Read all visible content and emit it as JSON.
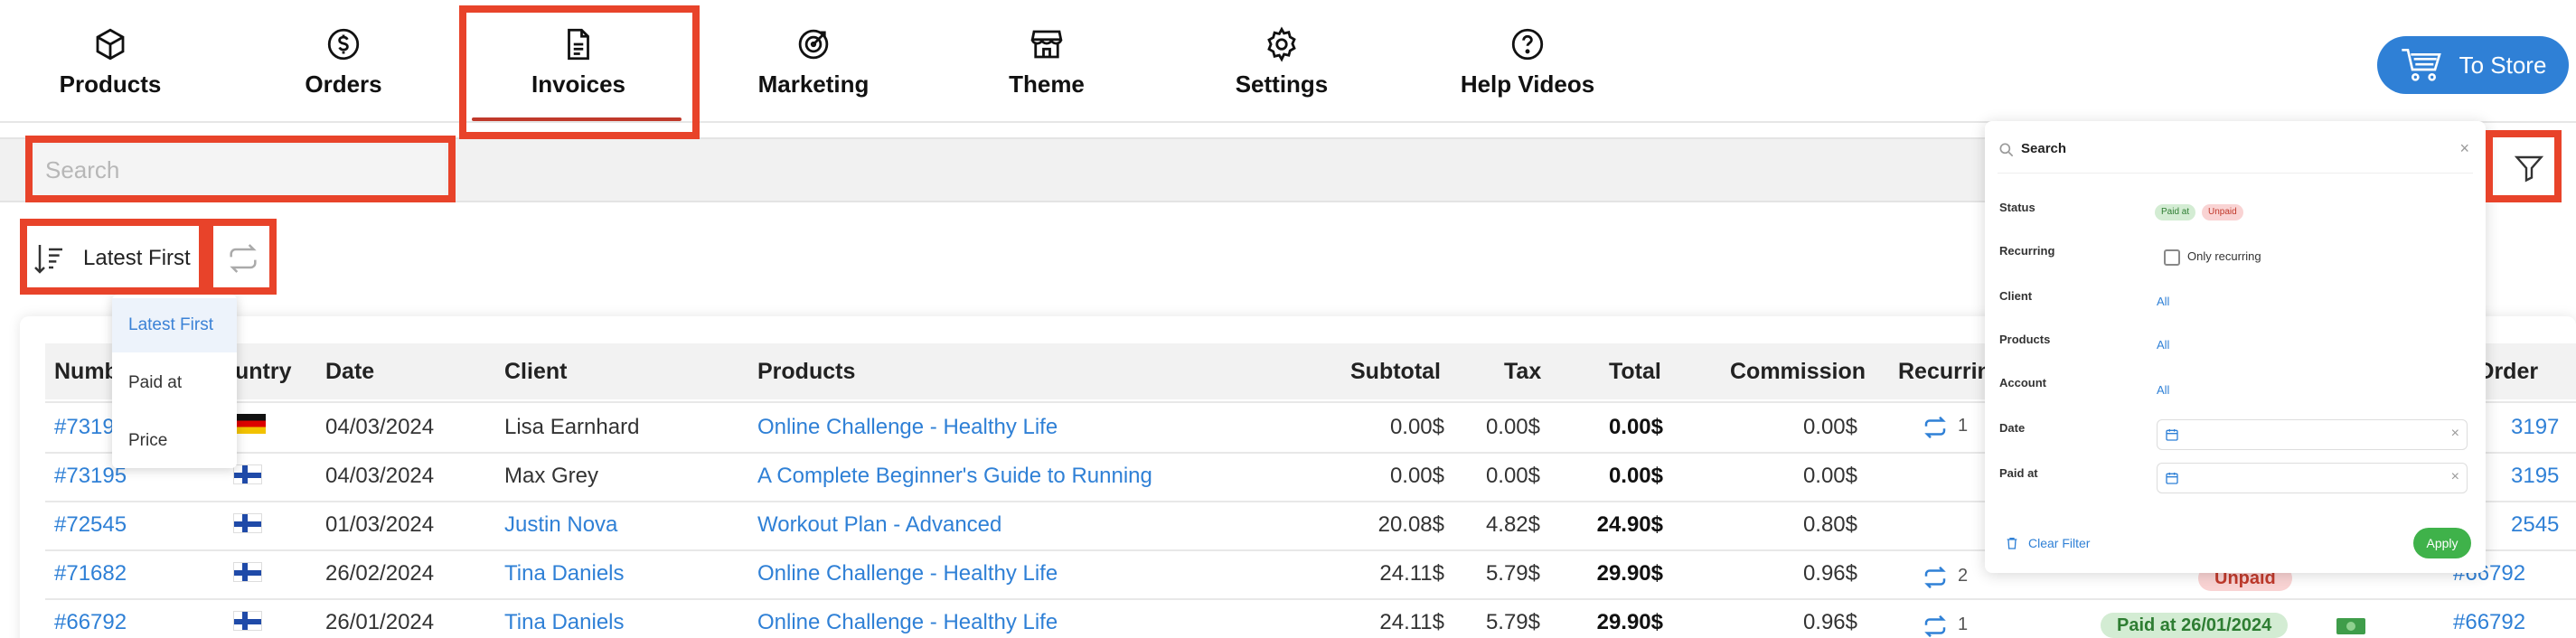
{
  "nav": {
    "tabs": [
      {
        "label": "Products",
        "icon": "box-icon"
      },
      {
        "label": "Orders",
        "icon": "dollar-icon"
      },
      {
        "label": "Invoices",
        "icon": "document-icon",
        "active": true
      },
      {
        "label": "Marketing",
        "icon": "target-icon"
      },
      {
        "label": "Theme",
        "icon": "shop-icon"
      },
      {
        "label": "Settings",
        "icon": "gear-icon"
      },
      {
        "label": "Help Videos",
        "icon": "help-icon"
      }
    ],
    "store_button": "To Store"
  },
  "search": {
    "placeholder": "Search"
  },
  "sort": {
    "label": "Latest First",
    "options": [
      "Latest First",
      "Paid at",
      "Price"
    ],
    "selected": "Latest First"
  },
  "table": {
    "columns": [
      "Number",
      "Country",
      "Date",
      "Client",
      "Products",
      "Subtotal",
      "Tax",
      "Total",
      "Commission",
      "Recurring",
      "Order"
    ],
    "col_number_visible": "Numb",
    "col_country_visible": "untry",
    "col_recurring_visible": "Recurrin",
    "col_order_visible": "Order",
    "rows": [
      {
        "number": "#7319",
        "country": "DE",
        "date": "04/03/2024",
        "client": "Lisa Earnhard",
        "client_link": false,
        "product": "Online Challenge - Healthy Life",
        "subtotal": "0.00$",
        "tax": "0.00$",
        "total": "0.00$",
        "commission": "0.00$",
        "recurring": "1",
        "status": "",
        "order": "3197"
      },
      {
        "number": "#73195",
        "country": "FI",
        "date": "04/03/2024",
        "client": "Max Grey",
        "client_link": false,
        "product": "A Complete Beginner's Guide to Running",
        "subtotal": "0.00$",
        "tax": "0.00$",
        "total": "0.00$",
        "commission": "0.00$",
        "recurring": "",
        "status": "",
        "order": "3195"
      },
      {
        "number": "#72545",
        "country": "FI",
        "date": "01/03/2024",
        "client": "Justin Nova",
        "client_link": true,
        "product": "Workout Plan - Advanced",
        "subtotal": "20.08$",
        "tax": "4.82$",
        "total": "24.90$",
        "commission": "0.80$",
        "recurring": "",
        "status": "",
        "order": "2545"
      },
      {
        "number": "#71682",
        "country": "FI",
        "date": "26/02/2024",
        "client": "Tina Daniels",
        "client_link": true,
        "product": "Online Challenge - Healthy Life",
        "subtotal": "24.11$",
        "tax": "5.79$",
        "total": "29.90$",
        "commission": "0.96$",
        "recurring": "2",
        "status": "Unpaid",
        "order": "#66792"
      },
      {
        "number": "#66792",
        "country": "FI",
        "date": "26/01/2024",
        "client": "Tina Daniels",
        "client_link": true,
        "product": "Online Challenge - Healthy Life",
        "subtotal": "24.11$",
        "tax": "5.79$",
        "total": "29.90$",
        "commission": "0.96$",
        "recurring": "1",
        "status": "Paid at 26/01/2024",
        "order": "#66792"
      }
    ]
  },
  "filter_panel": {
    "search_placeholder": "Search",
    "labels": {
      "status": "Status",
      "recurring": "Recurring",
      "client": "Client",
      "products": "Products",
      "account": "Account",
      "date": "Date",
      "paid_at": "Paid at"
    },
    "status_chips": [
      "Paid at",
      "Unpaid"
    ],
    "only_recurring": "Only recurring",
    "all": "All",
    "clear_filter": "Clear Filter",
    "apply": "Apply"
  },
  "colors": {
    "accent": "#2f80d6",
    "annotation": "#e8432a",
    "paid": "#2e7d32",
    "unpaid": "#c0392b"
  }
}
